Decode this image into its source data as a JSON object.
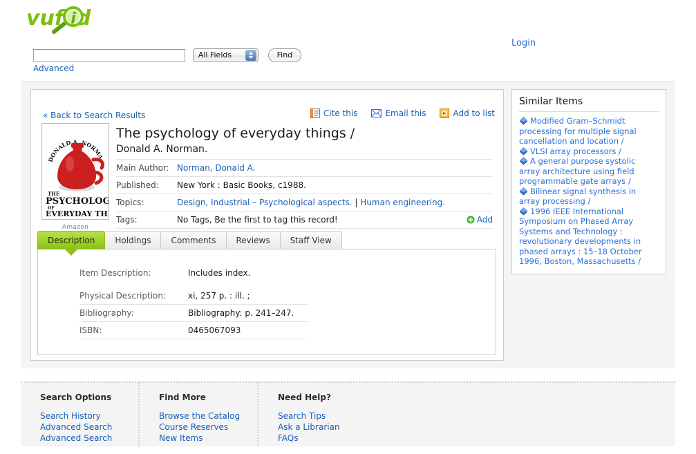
{
  "brand": {
    "name": "vufind",
    "accent": "#8cc115"
  },
  "header": {
    "login_label": "Login",
    "advanced_label": "Advanced",
    "search": {
      "value": "",
      "placeholder": "",
      "field_selected": "All Fields",
      "field_options": [
        "All Fields"
      ],
      "find_label": "Find"
    }
  },
  "record": {
    "back_label": "« Back to Search Results",
    "toolbar": [
      {
        "label": "Cite this",
        "icon": "cite-icon"
      },
      {
        "label": "Email this",
        "icon": "envelope-icon"
      },
      {
        "label": "Add to list",
        "icon": "add-to-list-icon"
      }
    ],
    "cover": {
      "credit": "Amazon",
      "alt": "The Psychology of Everyday Things book cover"
    },
    "title": "The psychology of everyday things /",
    "author_statement": "Donald A. Norman.",
    "fields": [
      {
        "key": "Main Author:",
        "value": "Norman, Donald A.",
        "link": true
      },
      {
        "key": "Published:",
        "value": "New York : Basic Books, c1988.",
        "link": false
      },
      {
        "key": "Topics:",
        "value": "",
        "link": true,
        "parts": [
          "Design, Industrial – Psychological aspects.",
          "|",
          "Human engineering."
        ]
      },
      {
        "key": "Tags:",
        "value": "No Tags, Be the first to tag this record!",
        "link": false,
        "action": "Add"
      }
    ],
    "tabs": [
      {
        "label": "Description",
        "active": true
      },
      {
        "label": "Holdings",
        "active": false
      },
      {
        "label": "Comments",
        "active": false
      },
      {
        "label": "Reviews",
        "active": false
      },
      {
        "label": "Staff View",
        "active": false
      }
    ],
    "description_rows": [
      {
        "key": "Item Description:",
        "value": "Includes index.",
        "gap": true
      },
      {
        "key": "Physical Description:",
        "value": "xi, 257 p. : ill. ;",
        "gap": false
      },
      {
        "key": "Bibliography:",
        "value": "Bibliography: p. 241–247.",
        "gap": false
      },
      {
        "key": "ISBN:",
        "value": "0465067093",
        "gap": false
      }
    ]
  },
  "similar": {
    "title": "Similar Items",
    "items": [
      "Modified Gram–Schmidt processing for multiple signal cancellation and location /",
      "VLSI array processors /",
      "A general purpose systolic array architecture using field programmable gate arrays /",
      "Bilinear signal synthesis in array processing /",
      "1996 IEEE International Symposium on Phased Array Systems and Technology : revolutionary developments in phased arrays : 15–18 October 1996, Boston, Massachusetts /"
    ]
  },
  "footer": {
    "columns": [
      {
        "heading": "Search Options",
        "links": [
          "Search History",
          "Advanced Search",
          "Advanced Search"
        ]
      },
      {
        "heading": "Find More",
        "links": [
          "Browse the Catalog",
          "Course Reserves",
          "New Items"
        ]
      },
      {
        "heading": "Need Help?",
        "links": [
          "Search Tips",
          "Ask a Librarian",
          "FAQs"
        ]
      }
    ]
  }
}
